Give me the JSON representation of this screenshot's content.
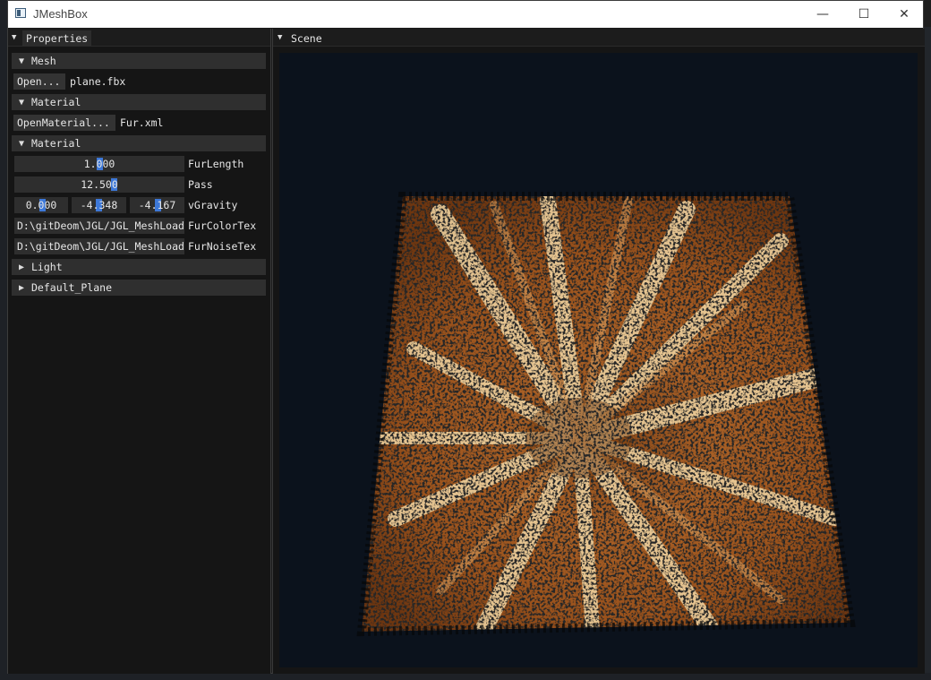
{
  "window": {
    "title": "JMeshBox",
    "controls": {
      "minimize": "—",
      "maximize": "☐",
      "close": "✕"
    }
  },
  "properties_panel": {
    "tab_label": "Properties",
    "mesh": {
      "header": "Mesh",
      "open_button": "Open...",
      "file_name": "plane.fbx"
    },
    "material_file": {
      "header": "Material",
      "open_button": "OpenMaterial...",
      "file_name": "Fur.xml"
    },
    "material": {
      "header": "Material",
      "fur_length": {
        "value": "1.000",
        "label": "FurLength",
        "fraction": 0.5
      },
      "pass": {
        "value": "12.500",
        "label": "Pass",
        "fraction": 0.5
      },
      "gravity": {
        "values": [
          "0.000",
          "-4.348",
          "-4.167"
        ],
        "label": "vGravity"
      },
      "fur_color_tex": {
        "value": "D:\\gitDeom\\JGL/JGL_MeshLoade",
        "label": "FurColorTex"
      },
      "fur_noise_tex": {
        "value": "D:\\gitDeom\\JGL/JGL_MeshLoade",
        "label": "FurNoiseTex"
      }
    },
    "light": {
      "header": "Light"
    },
    "default_plane": {
      "header": "Default_Plane"
    }
  },
  "scene_panel": {
    "tab_label": "Scene",
    "viewport_background": "#0b121c",
    "fur_colors": [
      "#7a3f12",
      "#b9742e",
      "#f3d9a8",
      "#050708"
    ]
  },
  "icons": {
    "collapse": "▼",
    "expand": "▶",
    "tab_menu": "▼"
  }
}
